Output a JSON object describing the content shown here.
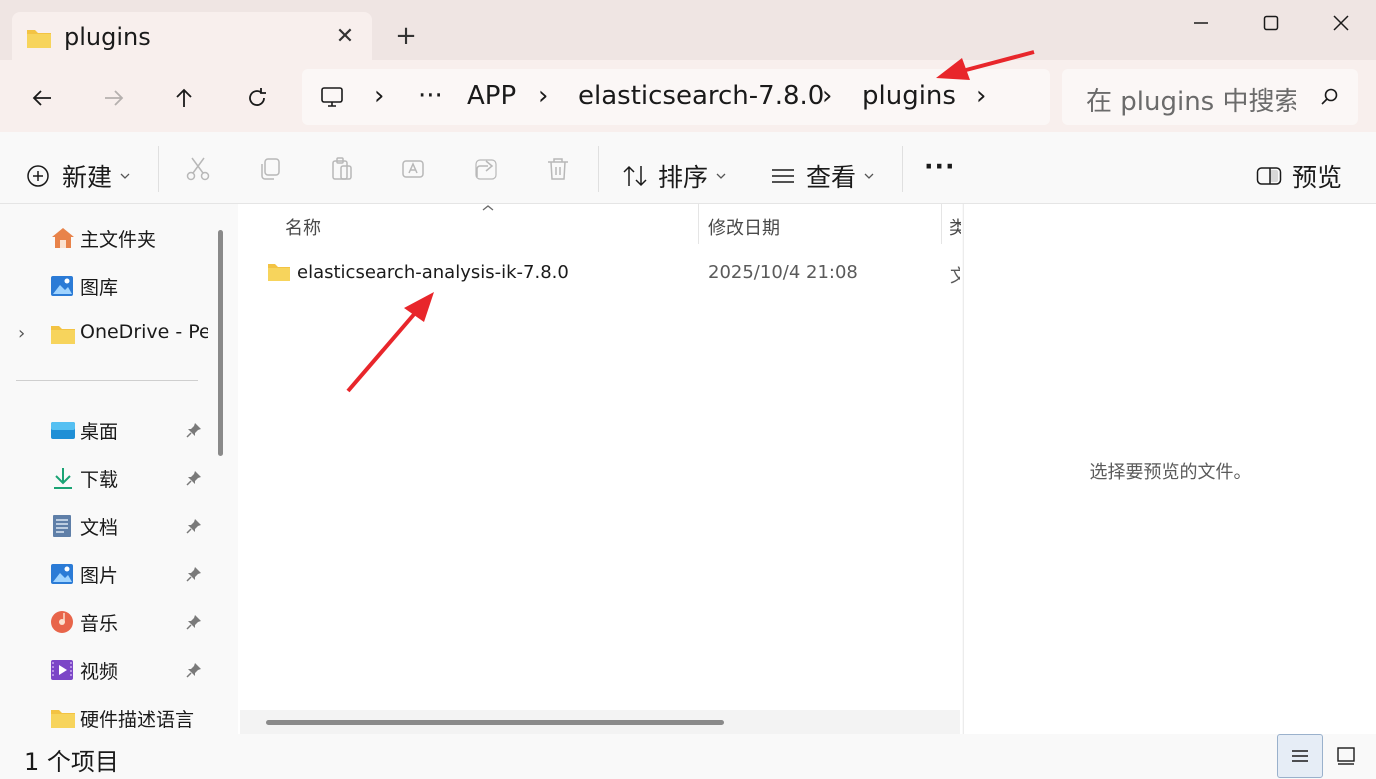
{
  "tab": {
    "title": "plugins",
    "close_glyph": "✕",
    "new_tab_glyph": "+"
  },
  "window": {
    "minimize": "minimize-icon",
    "maximize": "maximize-icon",
    "close": "close-icon"
  },
  "nav": {
    "back": "back-arrow-icon",
    "forward": "forward-arrow-icon",
    "up": "up-arrow-icon",
    "refresh": "refresh-icon"
  },
  "address": {
    "ellipsis": "···",
    "segments": [
      "APP",
      "elasticsearch-7.8.0",
      "plugins"
    ],
    "separator": "›"
  },
  "search": {
    "placeholder": "在 plugins 中搜索"
  },
  "toolbar": {
    "new_label": "新建",
    "sort_label": "排序",
    "view_label": "查看",
    "more_label": "···",
    "preview_label": "预览"
  },
  "sidebar": {
    "items": [
      {
        "label": "主文件夹",
        "icon": "home-icon"
      },
      {
        "label": "图库",
        "icon": "gallery-icon"
      },
      {
        "label": "OneDrive - Personal",
        "icon": "folder-icon"
      },
      {
        "label": "桌面",
        "icon": "desktop-icon"
      },
      {
        "label": "下载",
        "icon": "download-icon"
      },
      {
        "label": "文档",
        "icon": "document-icon"
      },
      {
        "label": "图片",
        "icon": "pictures-icon"
      },
      {
        "label": "音乐",
        "icon": "music-icon"
      },
      {
        "label": "视频",
        "icon": "video-icon"
      },
      {
        "label": "硬件描述语言",
        "icon": "folder-icon"
      }
    ]
  },
  "columns": {
    "name": "名称",
    "date": "修改日期",
    "type": "类型"
  },
  "files": [
    {
      "name": "elasticsearch-analysis-ik-7.8.0",
      "date": "2025/10/4 21:08",
      "type": "文件夹"
    }
  ],
  "preview": {
    "empty_text": "选择要预览的文件。"
  },
  "status": {
    "count": "1 个项目"
  },
  "colors": {
    "annotation_arrow": "#e8262b",
    "folder": "#f3c343",
    "titlebar": "#efe5e3"
  }
}
